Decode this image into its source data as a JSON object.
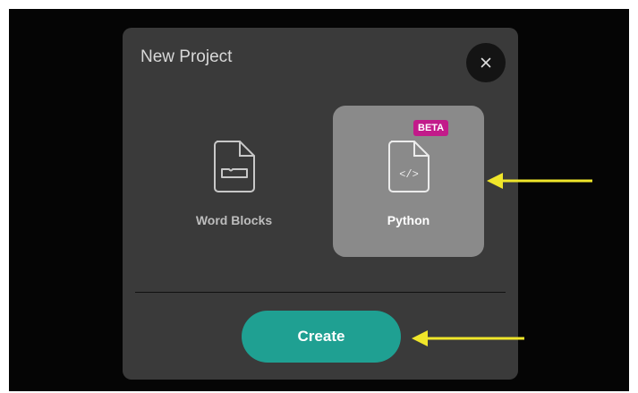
{
  "modal": {
    "title": "New Project"
  },
  "options": [
    {
      "label": "Word Blocks",
      "icon": "file-block-icon",
      "selected": false
    },
    {
      "label": "Python",
      "icon": "file-code-icon",
      "selected": true,
      "badge": "BETA",
      "code_glyph": "</>"
    }
  ],
  "actions": {
    "create_label": "Create"
  },
  "colors": {
    "modal_bg": "#3a3a3a",
    "selected_card": "#8a8a8a",
    "create_button": "#1fa092",
    "badge": "#c21b8a",
    "annotation_arrow": "#f0e62a"
  }
}
